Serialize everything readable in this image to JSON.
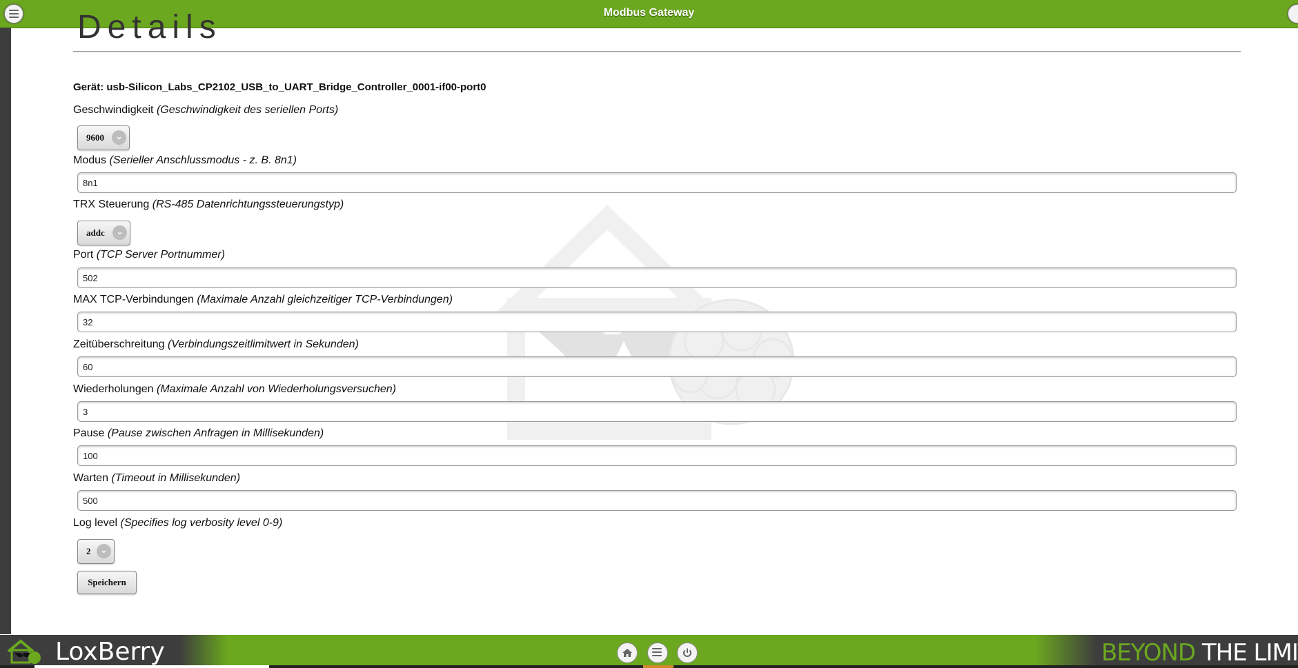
{
  "header": {
    "title": "Modbus Gateway"
  },
  "page": {
    "heading": "Details"
  },
  "device": {
    "label": "Gerät: usb-Silicon_Labs_CP2102_USB_to_UART_Bridge_Controller_0001-if00-port0"
  },
  "form": {
    "speed": {
      "label": "Geschwindigkeit",
      "hint": "(Geschwindigkeit des seriellen Ports)",
      "value": "9600"
    },
    "mode": {
      "label": "Modus",
      "hint": "(Serieller Anschlussmodus - z. B. 8n1)",
      "value": "8n1"
    },
    "trx": {
      "label": "TRX Steuerung",
      "hint": "(RS-485 Datenrichtungssteuerungstyp)",
      "value": "addc"
    },
    "port": {
      "label": "Port",
      "hint": "(TCP Server Portnummer)",
      "value": "502"
    },
    "maxconn": {
      "label": "MAX TCP-Verbindungen",
      "hint": "(Maximale Anzahl gleichzeitiger TCP-Verbindungen)",
      "value": "32"
    },
    "timeout": {
      "label": "Zeitüberschreitung",
      "hint": "(Verbindungszeitlimitwert in Sekunden)",
      "value": "60"
    },
    "retries": {
      "label": "Wiederholungen",
      "hint": "(Maximale Anzahl von Wiederholungsversuchen)",
      "value": "3"
    },
    "pause": {
      "label": "Pause",
      "hint": "(Pause zwischen Anfragen in Millisekunden)",
      "value": "100"
    },
    "wait": {
      "label": "Warten",
      "hint": "(Timeout in Millisekunden)",
      "value": "500"
    },
    "loglevel": {
      "label": "Log level",
      "hint": "(Specifies log verbosity level 0-9)",
      "value": "2"
    },
    "save_label": "Speichern"
  },
  "footer": {
    "brand": "LoxBerry",
    "tagline_part1": "BEYOND",
    "tagline_part2": " THE LIMITS"
  },
  "colors": {
    "accent": "#6ba81f",
    "dark": "#3d3d3d"
  }
}
